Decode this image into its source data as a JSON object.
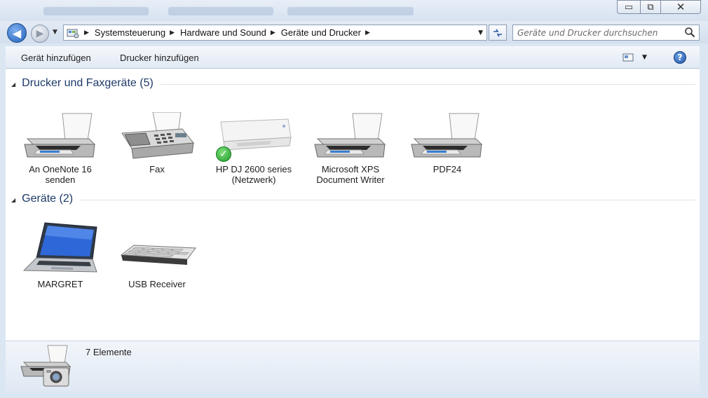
{
  "window": {
    "controls": {
      "minimize": "▭",
      "maximize": "⧉",
      "close": "✕"
    }
  },
  "nav": {
    "back_glyph": "◀",
    "forward_glyph": "▶",
    "breadcrumbs": [
      "Systemsteuerung",
      "Hardware und Sound",
      "Geräte und Drucker"
    ],
    "search_placeholder": "Geräte und Drucker durchsuchen"
  },
  "toolbar": {
    "add_device": "Gerät hinzufügen",
    "add_printer": "Drucker hinzufügen",
    "help": "?"
  },
  "groups": [
    {
      "title": "Drucker und Faxgeräte (5)",
      "items": [
        {
          "label": "An OneNote 16 senden",
          "icon": "printer-icon"
        },
        {
          "label": "Fax",
          "icon": "fax-icon"
        },
        {
          "label": "HP DJ 2600 series (Netzwerk)",
          "icon": "inkjet-printer-icon",
          "default": true
        },
        {
          "label": "Microsoft XPS Document Writer",
          "icon": "printer-icon"
        },
        {
          "label": "PDF24",
          "icon": "printer-icon"
        }
      ]
    },
    {
      "title": "Geräte (2)",
      "items": [
        {
          "label": "MARGRET",
          "icon": "laptop-icon"
        },
        {
          "label": "USB Receiver",
          "icon": "keyboard-icon"
        }
      ]
    }
  ],
  "details": {
    "count_text": "7 Elemente"
  },
  "colors": {
    "accent": "#1f5fb8",
    "group_title": "#1e3a68",
    "default_check": "#1f9a2a"
  }
}
